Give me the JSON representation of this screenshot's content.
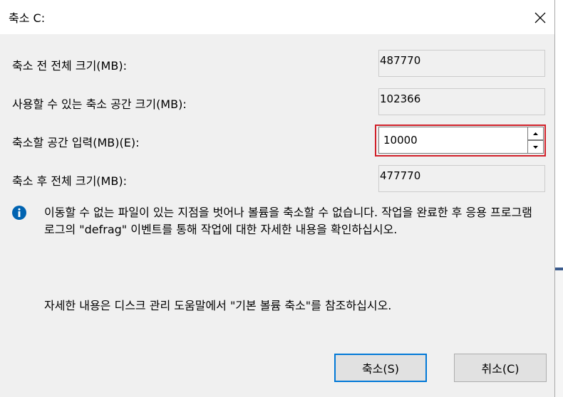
{
  "window": {
    "title": "축소 C:"
  },
  "fields": {
    "total_before": {
      "label": "축소 전 전체 크기(MB):",
      "value": "487770"
    },
    "available": {
      "label": "사용할 수 있는 축소 공간 크기(MB):",
      "value": "102366"
    },
    "shrink_amount": {
      "label": "축소할 공간 입력(MB)(E):",
      "value": "10000"
    },
    "total_after": {
      "label": "축소 후 전체 크기(MB):",
      "value": "477770"
    }
  },
  "info": {
    "icon": "info-icon",
    "message": "이동할 수 없는 파일이 있는 지점을 벗어나 볼륨을 축소할 수 없습니다. 작업을 완료한 후 응용 프로그램 로그의 \"defrag\" 이벤트를 통해 작업에 대한 자세한 내용을 확인하십시오.",
    "more": "자세한 내용은 디스크 관리 도움말에서 \"기본 볼륨 축소\"를 참조하십시오."
  },
  "buttons": {
    "shrink": "축소(S)",
    "cancel": "취소(C)"
  },
  "colors": {
    "dialog_bg": "#f0f0f0",
    "focus_highlight": "#d12029",
    "default_button_border": "#0078d7",
    "info_icon": "#0063b1"
  }
}
